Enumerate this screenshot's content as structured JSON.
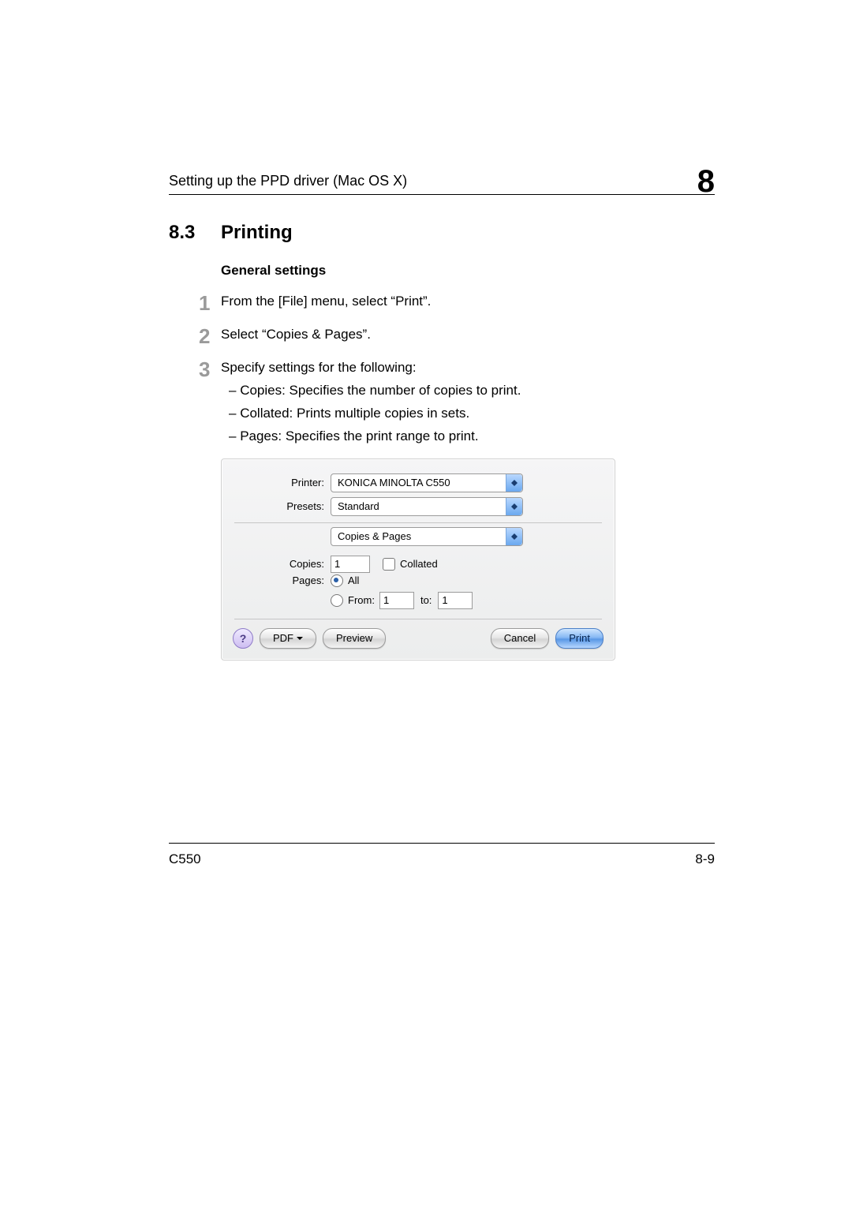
{
  "header": {
    "running_head": "Setting up the PPD driver (Mac OS X)",
    "chapter_number": "8"
  },
  "section": {
    "number": "8.3",
    "title": "Printing",
    "subheading": "General settings"
  },
  "steps": [
    {
      "num": "1",
      "text": "From the [File] menu, select “Print”."
    },
    {
      "num": "2",
      "text": "Select “Copies & Pages”."
    },
    {
      "num": "3",
      "text": "Specify settings for the following:",
      "subs": [
        "Copies: Specifies the number of copies to print.",
        "Collated: Prints multiple copies in sets.",
        "Pages: Specifies the print range to print."
      ]
    }
  ],
  "dialog": {
    "labels": {
      "printer": "Printer:",
      "presets": "Presets:",
      "copies": "Copies:",
      "pages": "Pages:",
      "collated": "Collated",
      "all": "All",
      "from": "From:",
      "to": "to:"
    },
    "values": {
      "printer": "KONICA MINOLTA C550",
      "presets": "Standard",
      "pane": "Copies & Pages",
      "copies": "1",
      "from": "1",
      "to": "1"
    },
    "buttons": {
      "help": "?",
      "pdf": "PDF",
      "preview": "Preview",
      "cancel": "Cancel",
      "print": "Print"
    }
  },
  "footer": {
    "model": "C550",
    "page": "8-9"
  }
}
